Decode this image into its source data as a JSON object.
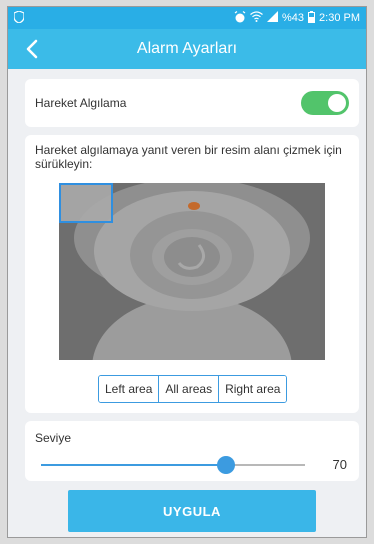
{
  "statusbar": {
    "battery_percent": "%43",
    "time": "2:30 PM",
    "icons": [
      "shield-icon",
      "alarm-icon",
      "wifi-icon",
      "signal-icon",
      "battery-icon"
    ]
  },
  "appbar": {
    "title": "Alarm Ayarları",
    "back_icon": "chevron-left-icon"
  },
  "motion": {
    "label": "Hareket Algılama",
    "enabled": true
  },
  "area": {
    "instructions": "Hareket algılamaya yanıt veren bir resim alanı çizmek için sürükleyin:",
    "buttons": {
      "left": "Left area",
      "all": "All areas",
      "right": "Right area"
    }
  },
  "level": {
    "label": "Seviye",
    "value": "70",
    "fraction": 0.7
  },
  "apply_label": "UYGULA",
  "colors": {
    "accent": "#3bbbe8",
    "toggle_on": "#52c46b",
    "slider": "#3c9be0"
  }
}
